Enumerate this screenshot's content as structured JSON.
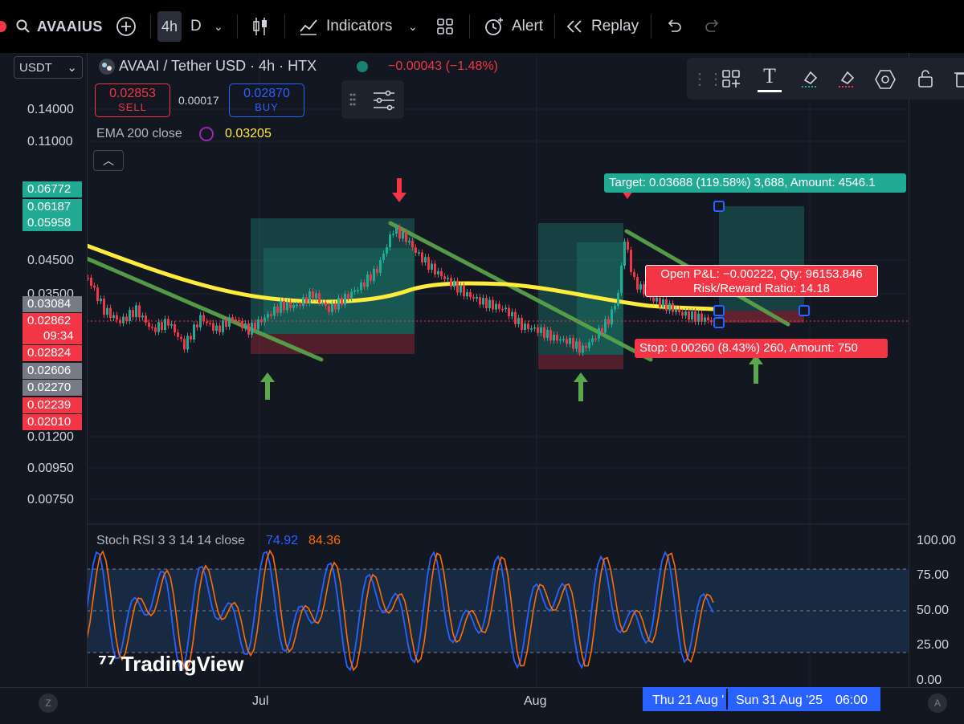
{
  "topbar": {
    "symbol": "AVAAIUS",
    "timeframe_active": "4h",
    "timeframe_alt": "D",
    "indicators_label": "Indicators",
    "alert_label": "Alert",
    "replay_label": "Replay"
  },
  "currency_select": "USDT",
  "legend": {
    "title": "AVAAI / Tether USD · 4h · HTX",
    "change": "−0.00043 (−1.48%)",
    "sell_price": "0.02853",
    "sell_label": "SELL",
    "spread": "0.00017",
    "buy_price": "0.02870",
    "buy_label": "BUY",
    "ema_label": "EMA 200 close",
    "ema_value": "0.03205"
  },
  "price_axis": [
    "0.14000",
    "0.11000",
    "0.04500",
    "0.03500",
    "0.01200",
    "0.00950",
    "0.00750"
  ],
  "price_tags": [
    {
      "text": "0.06772",
      "color": "#22ab94"
    },
    {
      "text": "0.06187",
      "color": "#22ab94"
    },
    {
      "text": "0.05958",
      "color": "#22ab94"
    },
    {
      "text": "0.03084",
      "color": "#787b86"
    },
    {
      "text": "0.02862",
      "color": "#f23645"
    },
    {
      "text": "09:34",
      "color": "#f23645"
    },
    {
      "text": "0.02824",
      "color": "#f23645"
    },
    {
      "text": "0.02606",
      "color": "#787b86"
    },
    {
      "text": "0.02270",
      "color": "#787b86"
    },
    {
      "text": "0.02239",
      "color": "#f23645"
    },
    {
      "text": "0.02010",
      "color": "#f23645"
    }
  ],
  "annotations": {
    "target": "Target: 0.03688 (119.58%) 3,688, Amount: 4546.1",
    "pnl_line1": "Open P&L: −0.00222, Qty: 96153.846",
    "pnl_line2": "Risk/Reward Ratio: 14.18",
    "stop": "Stop: 0.00260 (8.43%) 260, Amount: 750"
  },
  "stoch_rsi": {
    "title": "Stoch RSI 3 3 14 14 close",
    "k_value": "74.92",
    "d_value": "84.36",
    "axis": [
      "100.00",
      "75.00",
      "50.00",
      "25.00",
      "0.00"
    ],
    "k_color": "#2962ff",
    "d_color": "#ff6d00"
  },
  "time_axis": [
    "Jul",
    "Aug"
  ],
  "date_highlight": {
    "left": "Thu 21 Aug '",
    "right": "Sun 31 Aug '25",
    "time": "06:00"
  },
  "watermark": "TradingView",
  "corner_left": "Z",
  "corner_right": "A",
  "colors": {
    "ema": "#ffeb3b",
    "trend": "#5aa84a",
    "up": "#22ab94",
    "down": "#f23645"
  }
}
